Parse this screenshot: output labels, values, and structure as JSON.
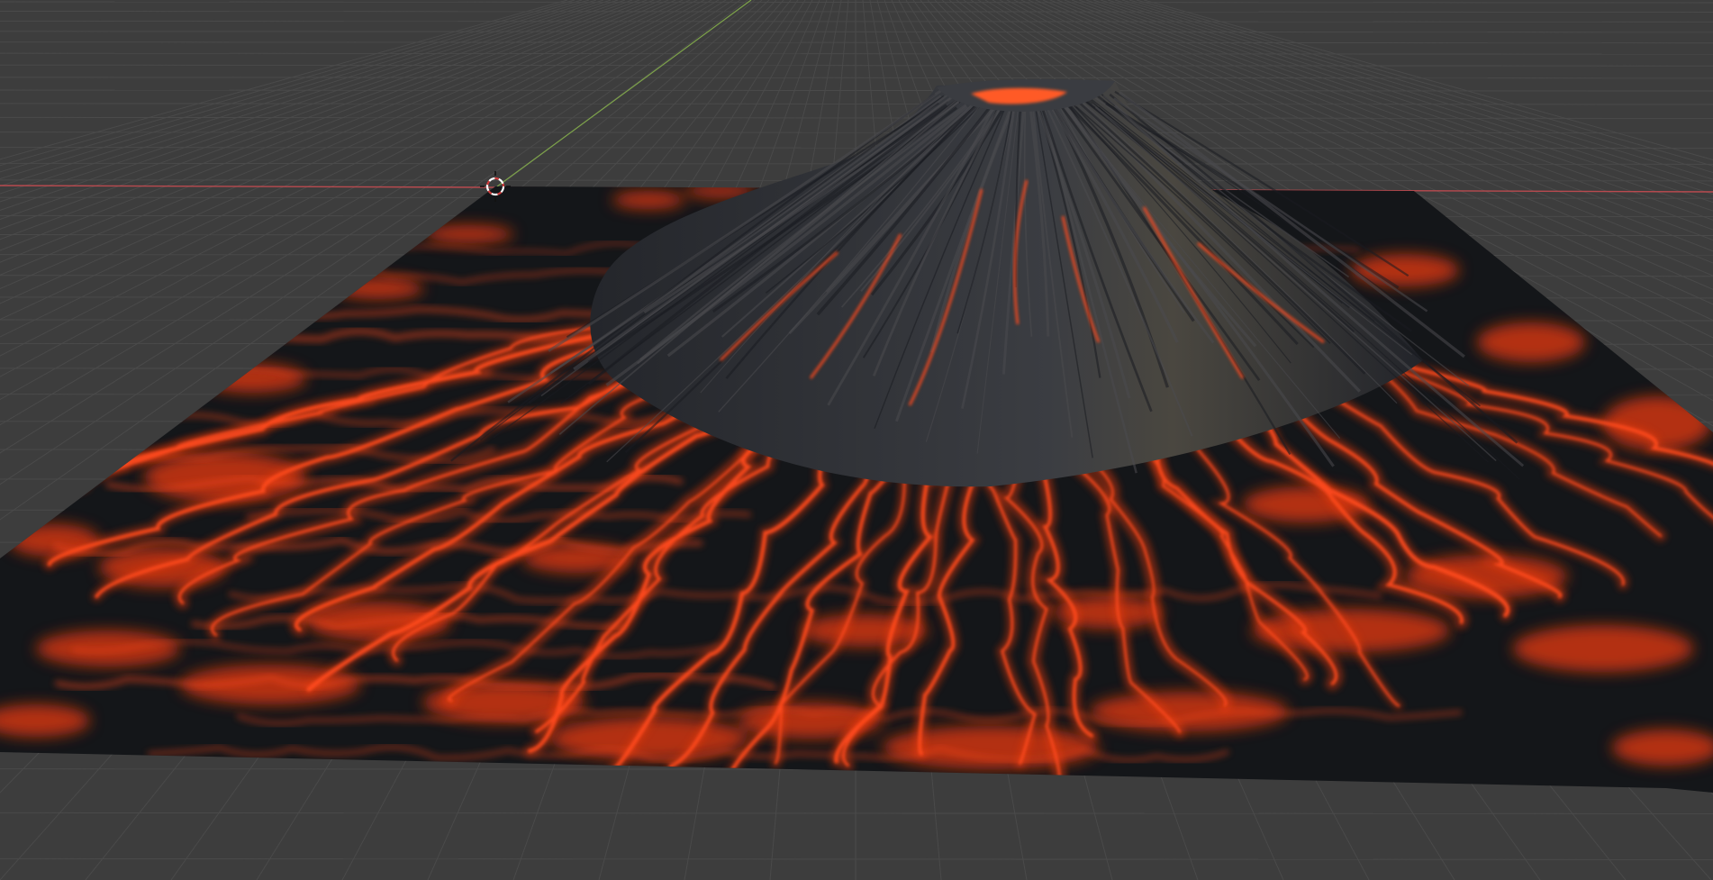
{
  "app": {
    "view": "3d-viewport",
    "scene_object": "volcano-terrain-mesh"
  },
  "colors": {
    "background": "#3d3d3d",
    "grid_line": "#4a4a4a",
    "x_axis": "#b94a4f",
    "y_axis": "#7da24a",
    "terrain_base": "#141619",
    "rock": "#2a2d33",
    "lava": "#ff4a1c",
    "lava_glow": "#e83a10"
  },
  "icons": {
    "cursor": "3d-cursor-icon"
  }
}
